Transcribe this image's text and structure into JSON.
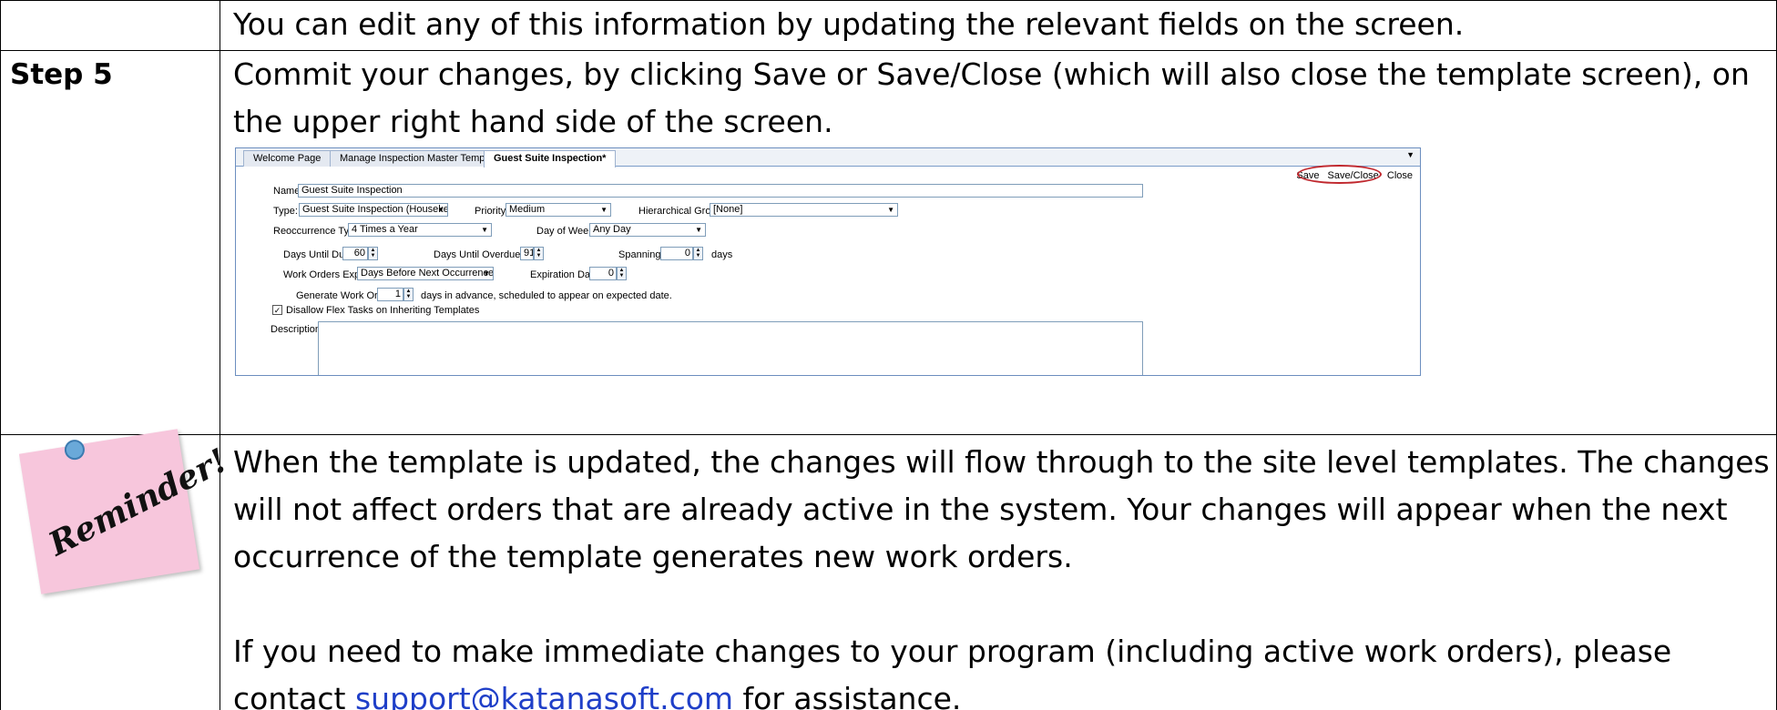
{
  "row1": {
    "text": "You can edit any of this information by updating the relevant fields on the screen."
  },
  "row2": {
    "step_label": "Step 5",
    "text": "Commit your changes, by clicking Save or Save/Close (which will also close the template screen), on the upper right hand side of the screen."
  },
  "screenshot": {
    "tabs": [
      "Welcome Page",
      "Manage Inspection Master Templates",
      "Guest Suite Inspection*"
    ],
    "tab_menu": "▼",
    "actions": {
      "save": "Save",
      "save_close": "Save/Close",
      "close": "Close"
    },
    "name_label": "Name:",
    "name_value": "Guest Suite Inspection",
    "type_label": "Type:",
    "type_value": "Guest Suite Inspection (Housekeeping)",
    "priority_label": "Priority:",
    "priority_value": "Medium",
    "hier_label": "Hierarchical Group:",
    "hier_value": "[None]",
    "reoccurrence_label": "Reoccurrence Type:",
    "reoccurrence_value": "4 Times a Year",
    "day_of_week_label": "Day of Week:",
    "day_of_week_value": "Any Day",
    "days_due_label": "Days Until Due:",
    "days_due_value": "60",
    "days_overdue_label": "Days Until Overdue:",
    "days_overdue_value": "91",
    "spanning_label": "Spanning:",
    "spanning_value": "0",
    "spanning_unit": "days",
    "wo_expire_label": "Work Orders Expire:",
    "wo_expire_value": "Days Before Next Occurrence",
    "expiration_days_label": "Expiration Days:",
    "expiration_days_value": "0",
    "generate_label": "Generate Work Orders",
    "generate_value": "1",
    "generate_suffix": "days in advance, scheduled to appear on expected date.",
    "disallow_label": "Disallow Flex Tasks on Inheriting Templates",
    "disallow_checked": "✓",
    "description_label": "Description:"
  },
  "row3": {
    "note_text": "Reminder!",
    "para1": "When the template is updated, the changes will flow through to the site level templates. The changes will not affect orders that are already active in the system. Your changes will appear when the next occurrence of the template generates new work orders.",
    "para2_before": "If you need to make immediate changes to your program (including active work orders), please contact ",
    "para2_link": "support@katanasoft.com",
    "para2_after": " for assistance."
  },
  "colors": {
    "highlight": "#c0272d",
    "link": "#1f3fc8",
    "note": "#f7c6dc"
  }
}
